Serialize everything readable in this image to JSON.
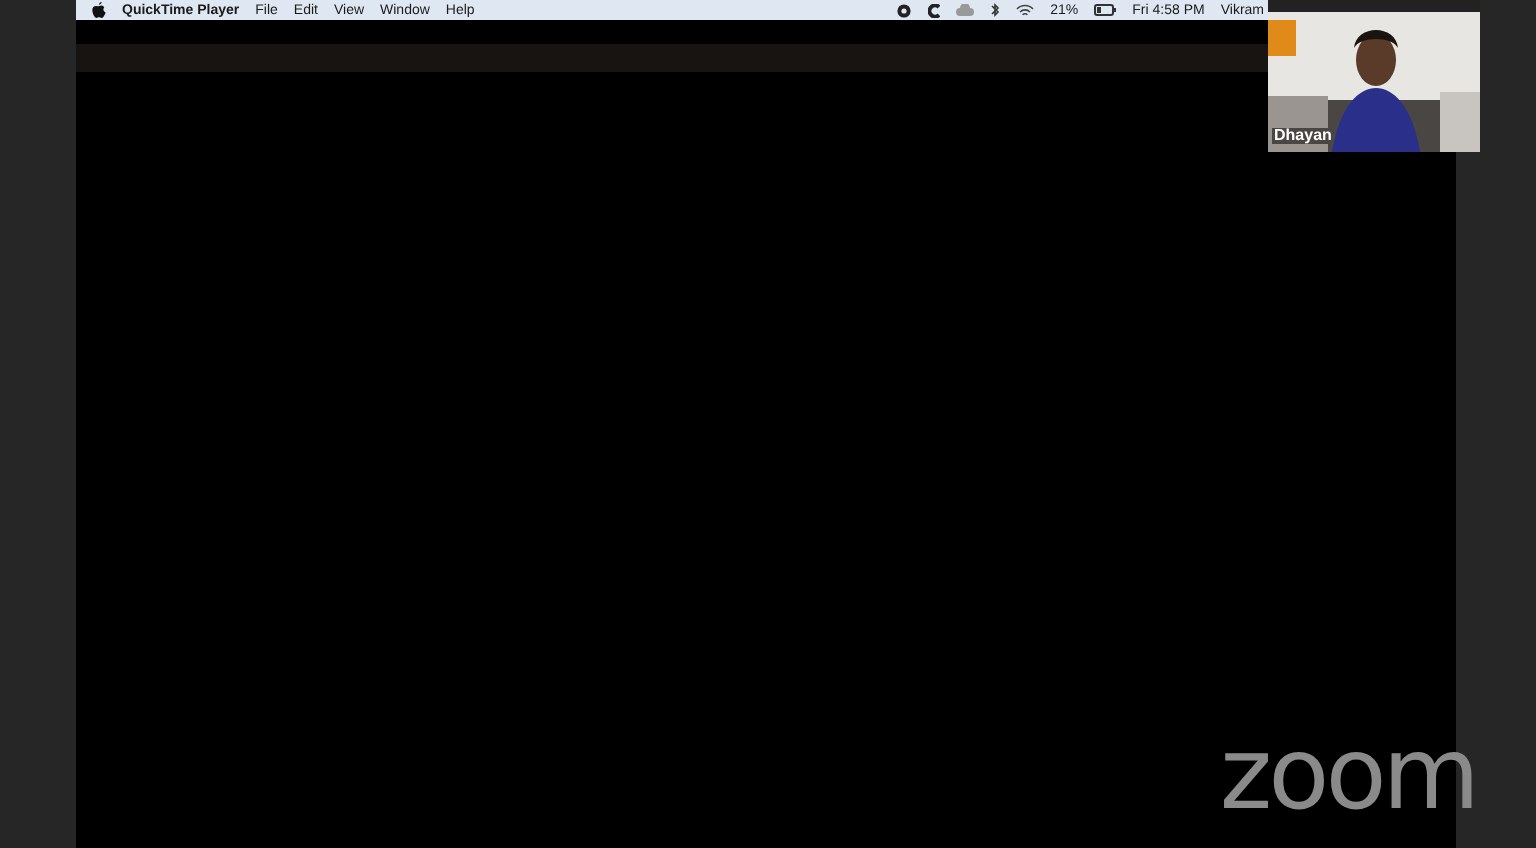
{
  "menu_bar": {
    "app_name": "QuickTime Player",
    "menus": [
      "File",
      "Edit",
      "View",
      "Window",
      "Help"
    ],
    "battery_percent": "21%",
    "clock": "Fri 4:58 PM",
    "user": "Vikram"
  },
  "video_tile": {
    "kind": "picture",
    "participant_name": "Dhayan"
  },
  "logo": "zoom"
}
